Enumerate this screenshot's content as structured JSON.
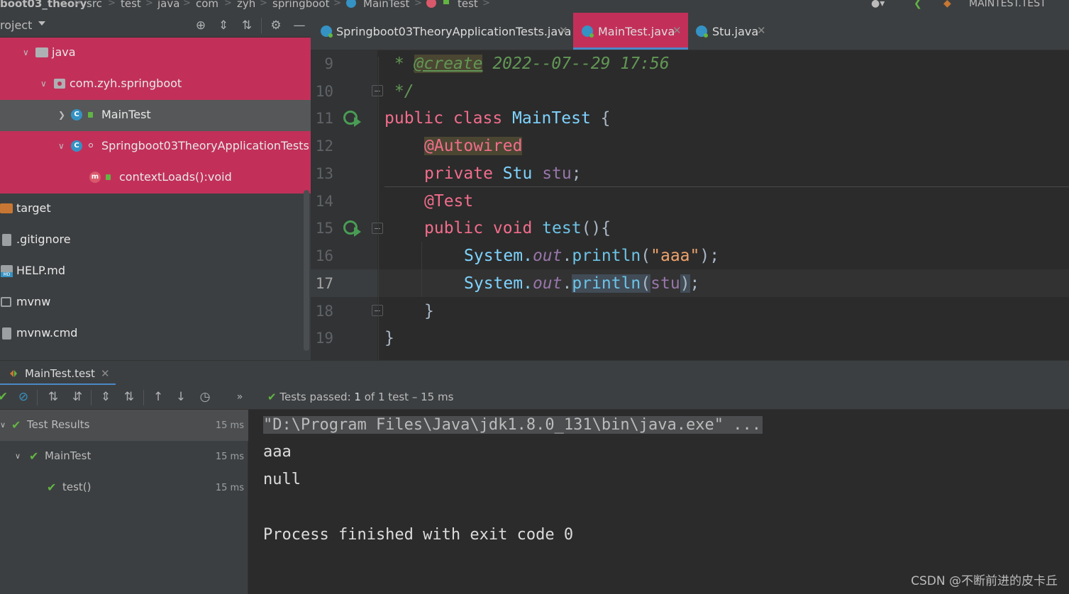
{
  "breadcrumb": {
    "items": [
      "boot03_theory",
      "src",
      "test",
      "java",
      "com",
      "zyh",
      "springboot",
      "MainTest",
      "test"
    ],
    "right_label": "MAINTEST.TEST"
  },
  "project": {
    "title": "roject",
    "tree": [
      {
        "label": "java",
        "state": "selected"
      },
      {
        "label": "com.zyh.springboot",
        "state": "selected"
      },
      {
        "label": "MainTest",
        "state": "current"
      },
      {
        "label": "Springboot03TheoryApplicationTests",
        "state": "selected"
      },
      {
        "label": "contextLoads():void",
        "state": "selected"
      },
      {
        "label": "target",
        "state": "normal"
      },
      {
        "label": ".gitignore",
        "state": "normal"
      },
      {
        "label": "HELP.md",
        "state": "normal"
      },
      {
        "label": "mvnw",
        "state": "normal"
      },
      {
        "label": "mvnw.cmd",
        "state": "normal"
      }
    ]
  },
  "tabs": [
    {
      "label": "Springboot03TheoryApplicationTests.java",
      "active": false
    },
    {
      "label": "MainTest.java",
      "active": true
    },
    {
      "label": "Stu.java",
      "active": false
    }
  ],
  "editor": {
    "line_numbers": [
      "9",
      "10",
      "11",
      "12",
      "13",
      "14",
      "15",
      "16",
      "17",
      "18",
      "19"
    ],
    "current_line": "17",
    "lines": {
      "l9_star": " * ",
      "l9_tag": "@create",
      "l9_rest": " 2022--07--29 17:56",
      "l10": " */",
      "l11_kw": "public class ",
      "l11_name": "MainTest",
      "l11_rest": " {",
      "l12_ann": "@Autowired",
      "l13_kw": "private ",
      "l13_type": "Stu",
      "l13_field": "stu",
      "l13_end": ";",
      "l14_ann": "@Test",
      "l15_kw": "public void ",
      "l15_name": "test",
      "l15_rest": "(){",
      "l16_sys": "System.",
      "l16_out": "out",
      "l16_dot": ".",
      "l16_mth": "println",
      "l16_open": "(",
      "l16_str": "\"aaa\"",
      "l16_close": ");",
      "l17_sys": "System.",
      "l17_out": "out",
      "l17_dot": ".",
      "l17_mth": "println",
      "l17_open": "(",
      "l17_arg": "stu",
      "l17_close": ")",
      "l17_end": ";",
      "l18": "}",
      "l19": "}"
    }
  },
  "run": {
    "tab_label": "MainTest.test",
    "status_prefix": "Tests passed: ",
    "status_count": "1",
    "status_rest": " of 1 test – 15 ms",
    "results": [
      {
        "label": "Test Results",
        "time": "15 ms"
      },
      {
        "label": "MainTest",
        "time": "15 ms"
      },
      {
        "label": "test()",
        "time": "15 ms"
      }
    ],
    "console": [
      "\"D:\\Program Files\\Java\\jdk1.8.0_131\\bin\\java.exe\" ...",
      "aaa",
      "null",
      "",
      "Process finished with exit code 0"
    ]
  },
  "watermark": "CSDN @不断前进的皮卡丘",
  "colors": {
    "selection": "#c2305a",
    "keyword": "#f26d8c",
    "success": "#62b543"
  }
}
